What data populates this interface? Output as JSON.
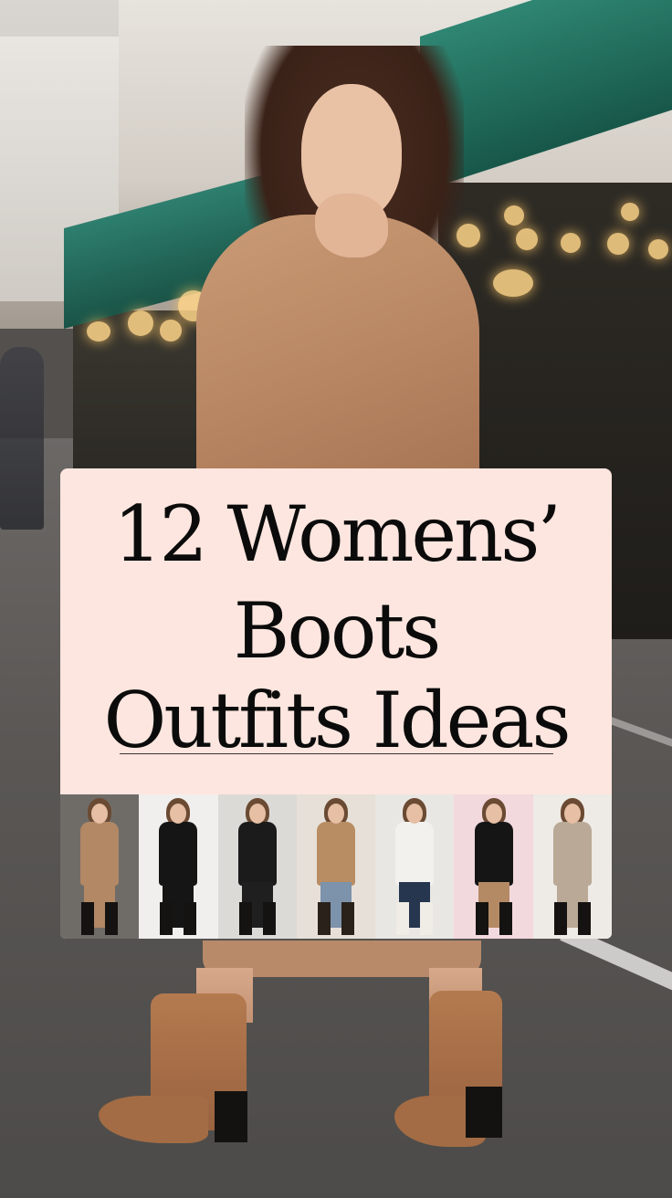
{
  "card": {
    "title_line1": "12 Womens’",
    "title_line2": "Boots",
    "title_line3": "Outfits Ideas"
  },
  "colors": {
    "card_background": "#fde6df",
    "title_text": "#0b0b0b",
    "coat": "#c99b76",
    "boots": "#b47a4f",
    "awning": "#1e6a5c"
  },
  "thumbnails": [
    {
      "name": "street-camel-coat-outfit",
      "bg": "#6f6c68",
      "top": "#b28865",
      "bottom": "#b28865",
      "boots": "#151311"
    },
    {
      "name": "black-dress-outfit",
      "bg": "#f1efed",
      "top": "#151515",
      "bottom": "#151515",
      "boots": "#151311"
    },
    {
      "name": "leather-jacket-dress-outfit",
      "bg": "#dcdad7",
      "top": "#1b1b1b",
      "bottom": "#1f1f1f",
      "boots": "#151311"
    },
    {
      "name": "camel-coat-ripped-jeans-outfit",
      "bg": "#e6e0d8",
      "top": "#b88d63",
      "bottom": "#7d92ab",
      "boots": "#2a211b"
    },
    {
      "name": "white-blouse-jeans-outfit",
      "bg": "#e9e7e4",
      "top": "#f3f1ee",
      "bottom": "#26364f",
      "boots": "#f0ece6"
    },
    {
      "name": "black-top-midi-skirt-outfit",
      "bg": "#f2d9dd",
      "top": "#151515",
      "bottom": "#b48a65",
      "boots": "#151311"
    },
    {
      "name": "beige-suit-outfit",
      "bg": "#eeeae5",
      "top": "#b9a996",
      "bottom": "#b9a996",
      "boots": "#151311"
    }
  ]
}
